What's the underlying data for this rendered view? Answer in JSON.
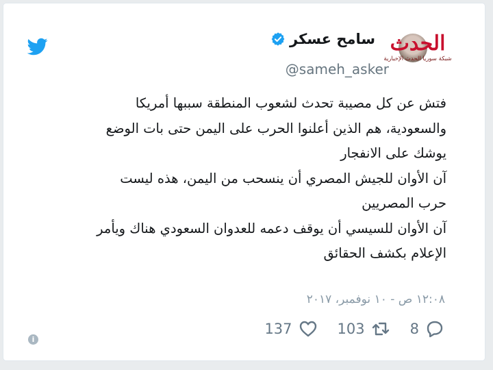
{
  "tweet": {
    "author_name": "سامح عسكر",
    "author_handle": "@sameh_asker",
    "text_lines": [
      "فتش عن كل مصيبة تحدث لشعوب المنطقة سببها أمريكا",
      "والسعودية، هم الذين أعلنوا الحرب على اليمن حتى بات الوضع",
      "يوشك على الانفجار",
      "آن الأوان للجيش المصري أن ينسحب من اليمن، هذه ليست",
      "حرب المصريين",
      "آن الأوان للسيسي أن يوقف دعمه للعدوان السعودي هناك ويأمر",
      "الإعلام بكشف الحقائق"
    ],
    "timestamp": "١٢:٠٨ ص - ١٠ نوفمبر، ٢٠١٧",
    "reply_count": "8",
    "retweet_count": "103",
    "like_count": "137",
    "info_glyph": "i"
  },
  "watermark": {
    "logo_text": "الحدث",
    "subtitle": "شبكة سوريا الحدث الإخبارية"
  },
  "icons": {
    "twitter": "twitter-bird-icon",
    "verified": "verified-badge-icon",
    "reply": "reply-icon",
    "retweet": "retweet-icon",
    "like": "heart-icon",
    "info": "info-icon"
  },
  "colors": {
    "twitter_blue": "#1da1f2",
    "action_gray": "#657786",
    "handle_gray": "#66757f",
    "watermark_red": "#c8102e"
  }
}
